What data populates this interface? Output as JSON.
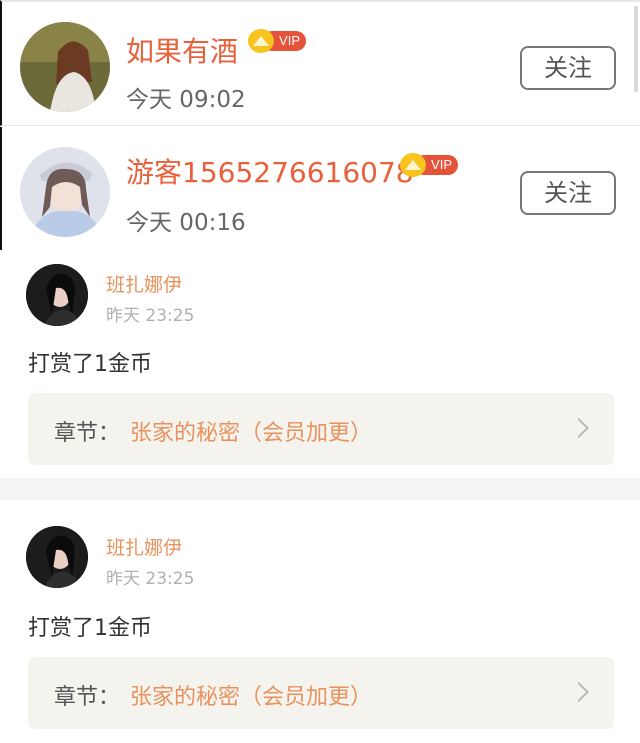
{
  "followers": [
    {
      "name": "如果有酒",
      "badge": "VIP",
      "time": "今天 09:02",
      "button": "关注"
    },
    {
      "name": "游客1565276616078",
      "badge": "VIP",
      "time": "今天 00:16",
      "button": "关注"
    }
  ],
  "rewards": [
    {
      "name": "班扎娜伊",
      "time": "昨天 23:25",
      "text": "打赏了1金币",
      "chapter_label": "章节：",
      "chapter_title": "张家的秘密（会员加更）"
    },
    {
      "name": "班扎娜伊",
      "time": "昨天 23:25",
      "text": "打赏了1金币",
      "chapter_label": "章节：",
      "chapter_title": "张家的秘密（会员加更）"
    }
  ],
  "colors": {
    "accent": "#e8603c",
    "reward_name": "#e9925d",
    "vip": "#e6533b",
    "crown": "#f7c31e"
  }
}
